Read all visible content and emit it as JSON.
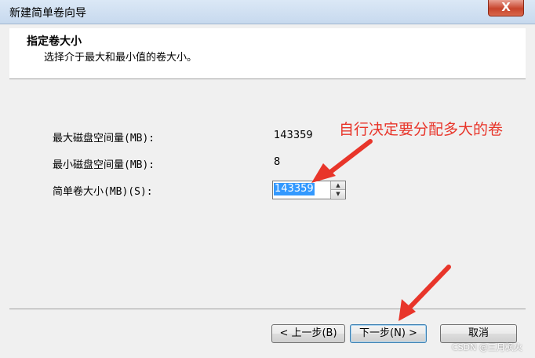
{
  "window": {
    "title": "新建简单卷向导",
    "close_glyph": "X"
  },
  "header": {
    "title": "指定卷大小",
    "subtitle": "选择介于最大和最小值的卷大小。"
  },
  "fields": {
    "max_label": "最大磁盘空间量(MB):",
    "max_value": "143359",
    "min_label": "最小磁盘空间量(MB):",
    "min_value": "8",
    "size_label": "简单卷大小(MB)(S):",
    "size_value": "143359"
  },
  "buttons": {
    "back": "< 上一步(B)",
    "next": "下一步(N) >",
    "cancel": "取消"
  },
  "annotation": {
    "text": "自行决定要分配多大的卷",
    "color": "#e8352a"
  },
  "watermark": "CSDN @三月枫火",
  "colors": {
    "selection": "#3399ff",
    "annotation": "#e8352a"
  }
}
